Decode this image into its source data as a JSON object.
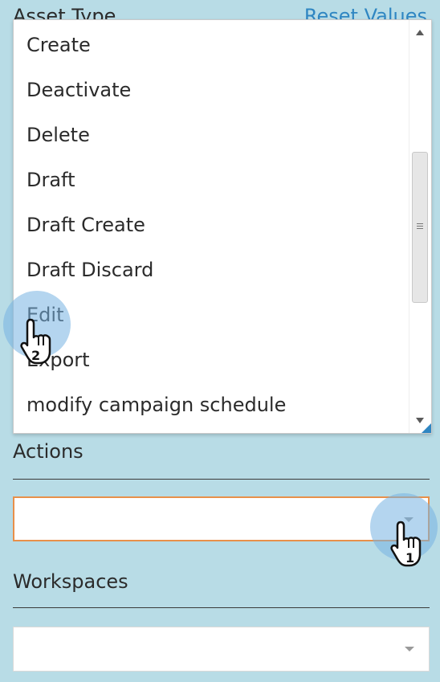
{
  "background": {
    "asset_type_label": "Asset Type",
    "reset_values_link": "Reset Values"
  },
  "dropdown": {
    "items": [
      "Create",
      "Deactivate",
      "Delete",
      "Draft",
      "Draft Create",
      "Draft Discard",
      "Edit",
      "Export",
      "modify campaign schedule"
    ],
    "hovered_item": "Edit"
  },
  "actions": {
    "label": "Actions",
    "value": ""
  },
  "workspaces": {
    "label": "Workspaces",
    "value": ""
  },
  "markers": {
    "step_1": "1",
    "step_2": "2"
  },
  "colors": {
    "background": "#b8dce6",
    "focus_border": "#e8904a",
    "link": "#2f86c2"
  }
}
